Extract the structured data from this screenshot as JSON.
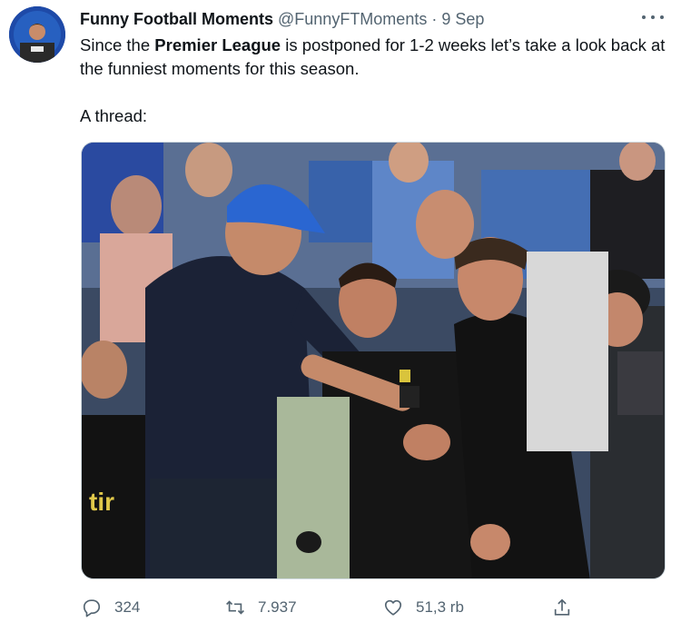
{
  "author": {
    "name": "Funny Football Moments",
    "handle": "@FunnyFTMoments",
    "separator": "·",
    "time": "9 Sep"
  },
  "tweet": {
    "line1_pre": "Since the ",
    "line1_bold": "Premier League",
    "line1_post": " is postponed for 1-2 weeks let’s take a look back at the funniest moments for this season.",
    "line2": "A thread:"
  },
  "media": {
    "shirt_sponsor_text": "tir"
  },
  "actions": {
    "reply": {
      "icon": "reply-icon",
      "count": "324"
    },
    "retweet": {
      "icon": "retweet-icon",
      "count": "7.937"
    },
    "like": {
      "icon": "heart-icon",
      "count": "51,3 rb"
    },
    "share": {
      "icon": "share-icon"
    }
  },
  "colors": {
    "text": "#0f1419",
    "muted": "#536471",
    "border": "#cfd9de"
  }
}
